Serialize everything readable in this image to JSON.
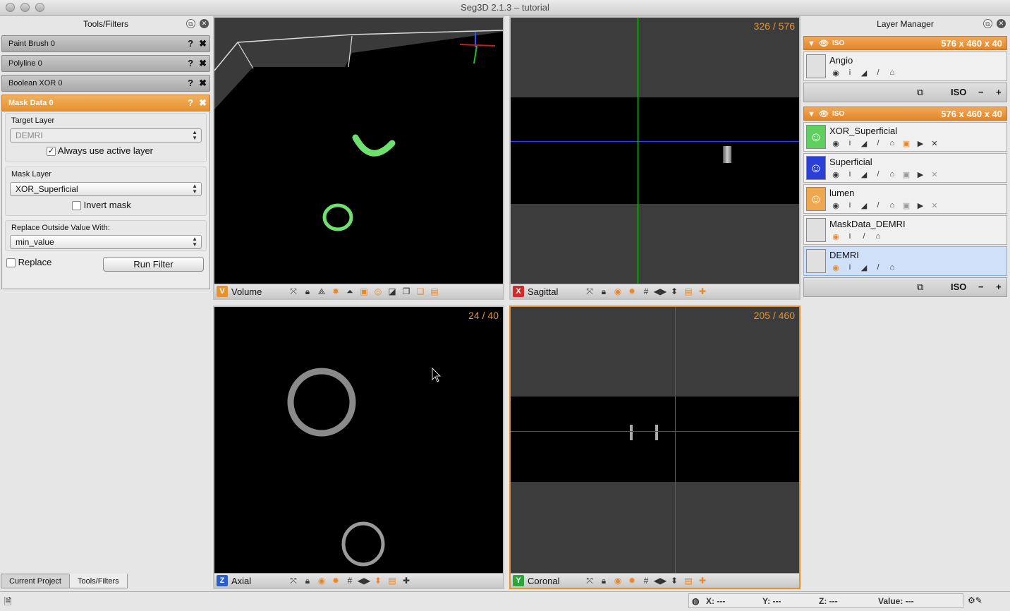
{
  "window": {
    "title": "Seg3D  2.1.3 – tutorial"
  },
  "tools_panel": {
    "title": "Tools/Filters",
    "tools": [
      {
        "label": "Paint Brush 0"
      },
      {
        "label": "Polyline 0"
      },
      {
        "label": "Boolean XOR 0"
      }
    ],
    "active_tool": {
      "label": "Mask Data 0",
      "target_layer_label": "Target Layer",
      "target_layer_value": "DEMRI",
      "always_active_label": "Always use active layer",
      "always_active_checked": "✓",
      "mask_layer_label": "Mask Layer",
      "mask_layer_value": "XOR_Superficial",
      "invert_mask_label": "Invert mask",
      "replace_outside_label": "Replace Outside Value With:",
      "replace_outside_value": "min_value",
      "replace_label": "Replace",
      "run_filter_label": "Run Filter"
    },
    "help_glyph": "?",
    "close_glyph": "✖",
    "tabs": [
      {
        "label": "Current Project"
      },
      {
        "label": "Tools/Filters"
      }
    ]
  },
  "viewers": {
    "volume": {
      "badge": "V",
      "name": "Volume",
      "badge_color": "#e8922e"
    },
    "sagittal": {
      "badge": "X",
      "name": "Sagittal",
      "slice": "326 / 576",
      "badge_color": "#d02b2b"
    },
    "axial": {
      "badge": "Z",
      "name": "Axial",
      "slice": "24 / 40",
      "badge_color": "#2b5fc8"
    },
    "coronal": {
      "badge": "Y",
      "name": "Coronal",
      "slice": "205 / 460",
      "badge_color": "#2aa63a"
    }
  },
  "layer_manager": {
    "title": "Layer Manager",
    "groups": [
      {
        "name": "ISO",
        "size": "576 x 460 x 40",
        "layers": [
          {
            "name": "Angio"
          }
        ]
      },
      {
        "name": "ISO",
        "size": "576 x 460 x 40",
        "layers": [
          {
            "name": "XOR_Superficial",
            "color": "#5fcf5f"
          },
          {
            "name": "Superficial",
            "color": "#2b3fd8"
          },
          {
            "name": "lumen",
            "color": "#f0a850"
          },
          {
            "name": "MaskData_DEMRI"
          },
          {
            "name": "DEMRI"
          }
        ]
      }
    ],
    "footer_iso": "ISO",
    "footer_minus": "−",
    "footer_plus": "+"
  },
  "status_bar": {
    "x_label": "X: ---",
    "y_label": "Y: ---",
    "z_label": "Z: ---",
    "value_label": "Value: ---"
  }
}
